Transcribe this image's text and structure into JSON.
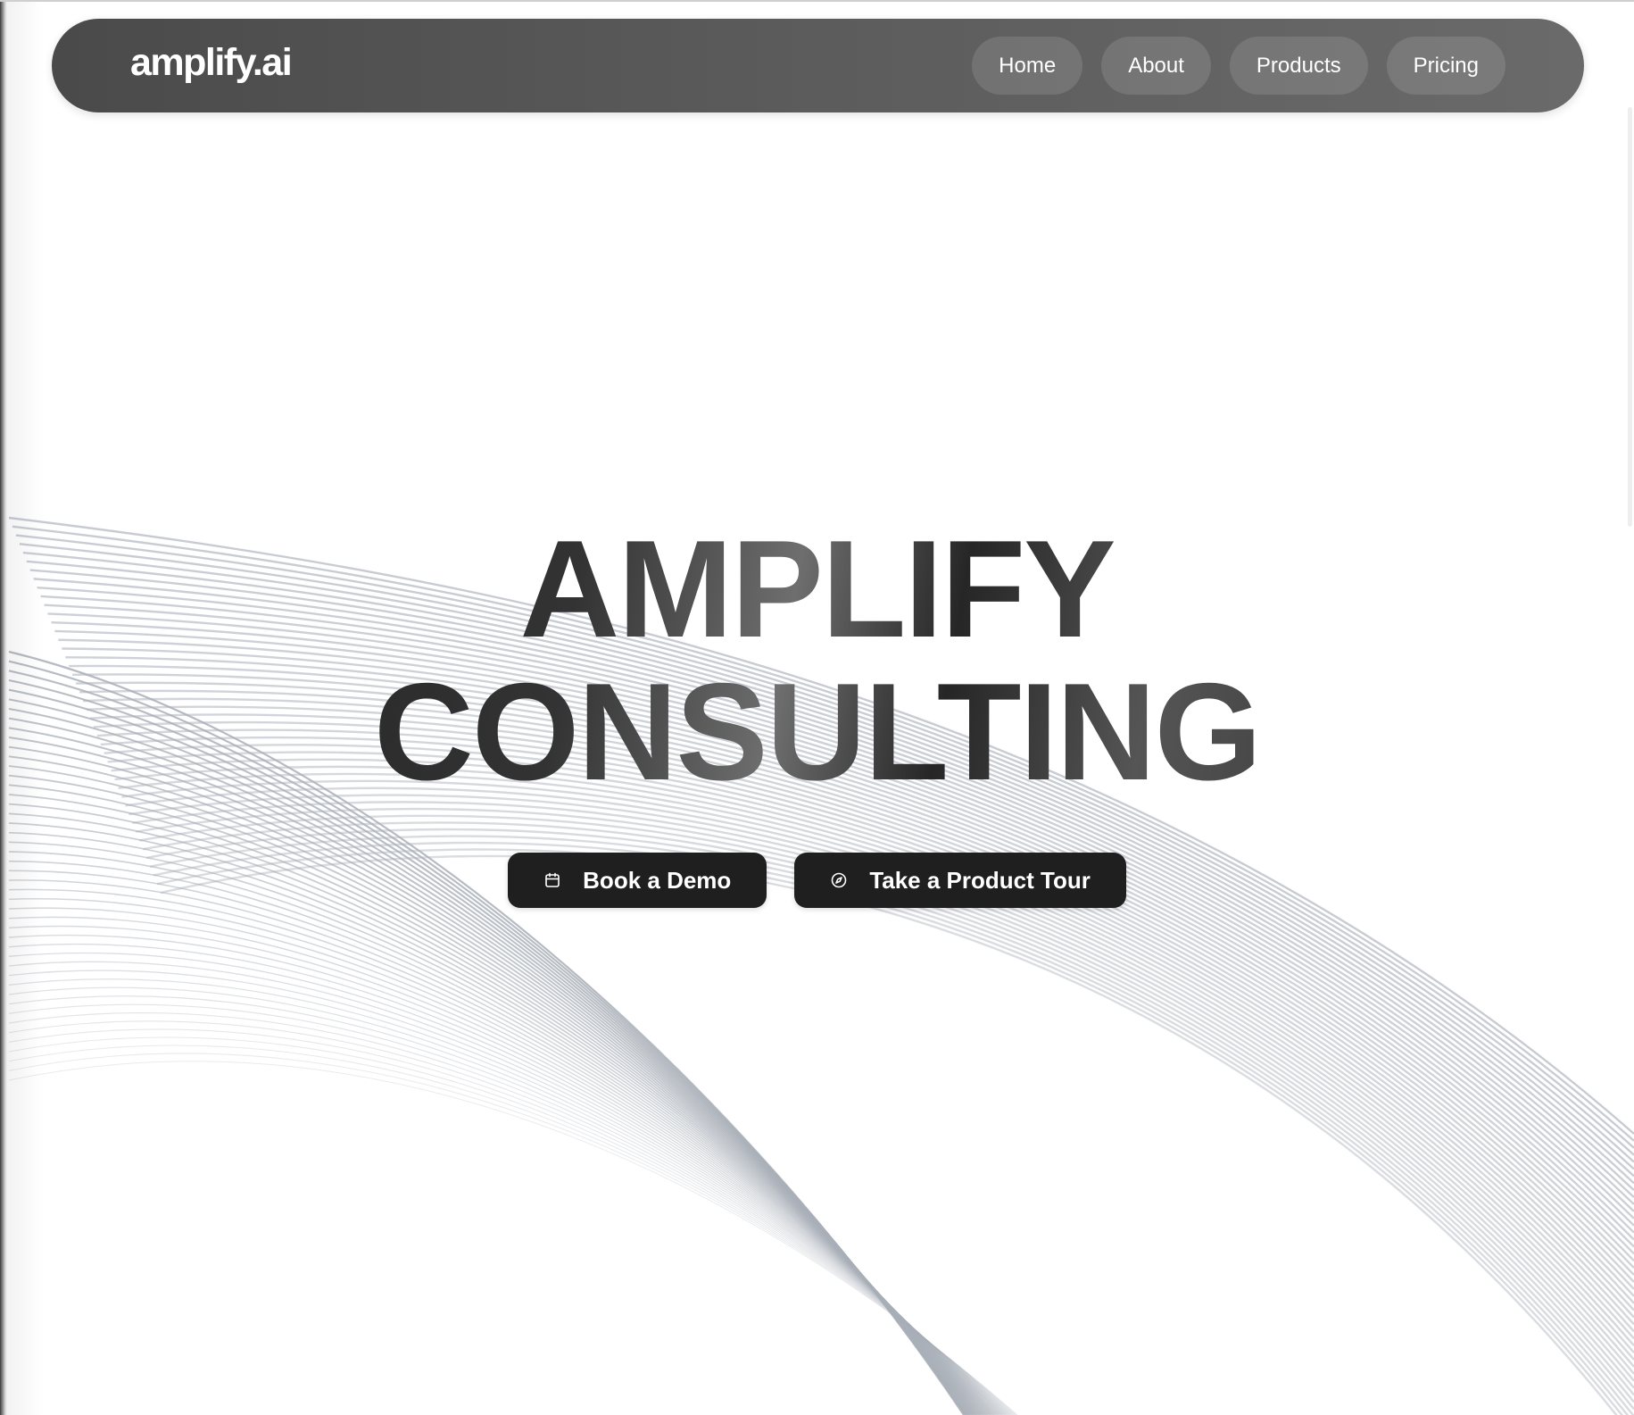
{
  "brand": {
    "logo_text": "amplify.ai"
  },
  "nav": {
    "items": [
      {
        "label": "Home"
      },
      {
        "label": "About"
      },
      {
        "label": "Products"
      },
      {
        "label": "Pricing"
      }
    ]
  },
  "hero": {
    "title_line1": "AMPLIFY",
    "title_line2": "CONSULTING"
  },
  "cta": {
    "primary_label": "Book a Demo",
    "primary_icon": "calendar-icon",
    "secondary_label": "Take a Product Tour",
    "secondary_icon": "compass-icon"
  },
  "colors": {
    "navbar": "#555555",
    "button": "#1f1f1f",
    "wave_lines": "#c5c9d0",
    "background": "#ffffff"
  }
}
